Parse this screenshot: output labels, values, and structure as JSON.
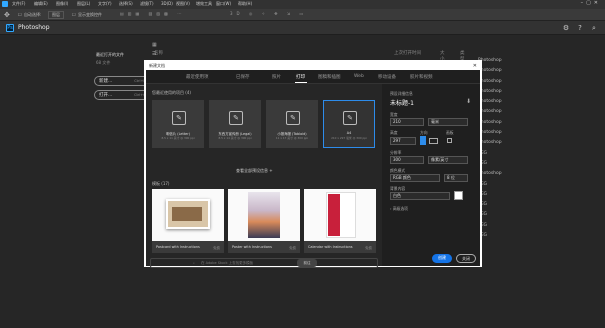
{
  "menubar": {
    "items": [
      "文件(F)",
      "编辑(E)",
      "图像(I)",
      "图层(L)",
      "文字(Y)",
      "选择(S)",
      "滤镜(T)",
      "3D(D)",
      "视图(V)",
      "增效工具",
      "窗口(W)",
      "帮助(H)"
    ]
  },
  "optbar": {
    "mode_label": "自动选择:",
    "mode_value": "图层",
    "transform_label": "显示变换控件"
  },
  "app": {
    "title": "Photoshop",
    "logo_text": "Ps"
  },
  "home": {
    "recent_title": "最近打开的文件",
    "recent_count": "68 文件",
    "new_label": "新建...",
    "new_shortcut": "Ctrl+N",
    "open_label": "打开...",
    "open_shortcut": "Ctrl+O",
    "col_name": "名称",
    "col_opened": "上次打开时间",
    "col_size": "大小",
    "col_type": "类型",
    "right_list": [
      "Photoshop",
      "Photoshop",
      "Photoshop",
      "Photoshop",
      "Photoshop",
      "Photoshop",
      "Photoshop",
      "Photoshop",
      "Photoshop",
      "PEG",
      "PEG",
      "Photoshop",
      "PEG",
      "PEG",
      "PEG",
      "PEG",
      "PEG",
      "PEG"
    ]
  },
  "dialog": {
    "title": "新建文档",
    "tabs": [
      "最近使用项",
      "已保存",
      "照片",
      "打印",
      "图稿和插图",
      "Web",
      "移动设备",
      "胶片和视频"
    ],
    "active_tab": "打印",
    "recent_header": "您最近使用的项目 (4)",
    "recent": [
      {
        "name": "明信片 (Letter)",
        "size": "8.5 x 11 英寸 @ 300 ppi"
      },
      {
        "name": "东西方宣传册 (Legal)",
        "size": "8.5 x 14 英寸 @ 300 ppi"
      },
      {
        "name": "小报海报 (Tabloid)",
        "size": "11 x 17 英寸 @ 300 ppi"
      },
      {
        "name": "A4",
        "size": "210 x 297 毫米 @ 300 ppi"
      }
    ],
    "view_all": "查看全部预设信息",
    "templates_header": "模板 (17)",
    "templates": [
      {
        "name": "Postcard with Instructions",
        "price": "免费"
      },
      {
        "name": "Poster with Instructions",
        "price": "免费"
      },
      {
        "name": "Calendar with Instructions",
        "price": "免费"
      }
    ],
    "search_placeholder": "在 Adobe Stock 上查找更多模板",
    "search_go": "前往",
    "details": {
      "header": "预设详细信息",
      "doc_name": "未标题-1",
      "width_label": "宽度",
      "width_value": "210",
      "width_unit": "毫米",
      "height_label": "高度",
      "height_value": "297",
      "orientation_label": "方向",
      "artboard_label": "画板",
      "resolution_label": "分辨率",
      "resolution_value": "300",
      "resolution_unit": "像素/英寸",
      "color_mode_label": "颜色模式",
      "color_mode_value": "RGB 颜色",
      "bit_depth": "8 位",
      "bg_label": "背景内容",
      "bg_value": "白色",
      "advanced_label": "高级选项",
      "create_label": "创建",
      "close_label": "关闭"
    }
  },
  "colors": {
    "accent": "#2d8ceb",
    "ps_blue": "#31a8ff",
    "bg": "#262626"
  }
}
